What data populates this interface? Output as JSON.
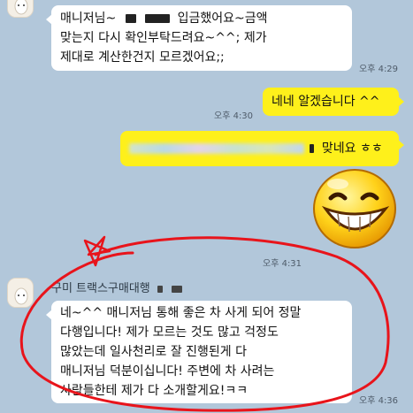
{
  "messages": [
    {
      "id": "m1",
      "direction": "incoming",
      "lines": [
        "매니저님~",
        "입금했어요~금액",
        "맞는지 다시 확인부탁드려요~^^; 제가",
        "제대로 계산한건지 모르겠어요;;"
      ],
      "time": "오후 4:29"
    },
    {
      "id": "m2",
      "direction": "outgoing",
      "text": "네네 알겠습니다 ^^",
      "time": "오후 4:30"
    },
    {
      "id": "m3",
      "direction": "outgoing",
      "text_suffix": "맞네요 ㅎㅎ",
      "time": ""
    },
    {
      "id": "m4",
      "direction": "outgoing",
      "emoticon": "grinning-face-emoticon",
      "time": "오후 4:31"
    },
    {
      "id": "m5",
      "direction": "incoming",
      "sender": "구미 트랙스구매대행",
      "lines": [
        "네~^^ 매니저님 통해 좋은 차 사게 되어 정말",
        "다행입니다! 제가 모르는 것도 많고 걱정도",
        "많았는데 일사천리로 잘 진행된게 다",
        "매니저님 덕분이십니다! 주변에 차 사려는",
        "사람들한테 제가 다 소개할게요!ㅋㅋ"
      ],
      "time": "오후 4:36"
    }
  ],
  "colors": {
    "background": "#b2c7da",
    "incoming_bubble": "#ffffff",
    "outgoing_bubble": "#fef01b",
    "annotation": "#e8141b"
  },
  "icons": [
    "user-avatar",
    "grinning-face-emoticon",
    "hand-drawn-red-circle"
  ]
}
